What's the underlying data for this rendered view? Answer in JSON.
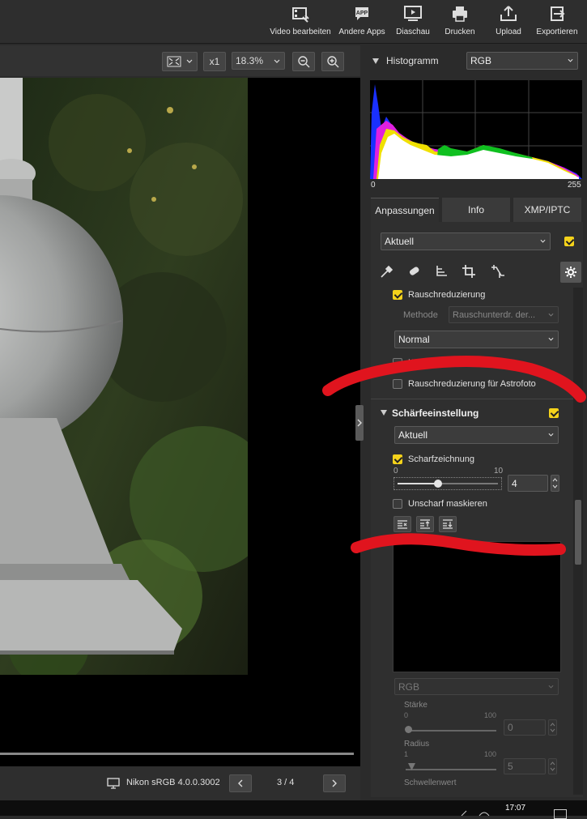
{
  "toolbar": {
    "items": [
      {
        "label": "Video bearbeiten",
        "icon": "video-edit-icon"
      },
      {
        "label": "Andere Apps",
        "icon": "apps-icon"
      },
      {
        "label": "Diaschau",
        "icon": "slideshow-icon"
      },
      {
        "label": "Drucken",
        "icon": "print-icon"
      },
      {
        "label": "Upload",
        "icon": "upload-icon"
      },
      {
        "label": "Exportieren",
        "icon": "export-icon"
      }
    ]
  },
  "viewer_bar": {
    "zoom_ratio_label": "x1",
    "zoom_level": "18.3%"
  },
  "status": {
    "color_profile": "Nikon sRGB 4.0.0.3002",
    "page_indicator": "3 / 4"
  },
  "taskbar": {
    "time": "17:07"
  },
  "histogram": {
    "title": "Histogramm",
    "channel": "RGB",
    "axis_min": "0",
    "axis_max": "255"
  },
  "tabs": [
    {
      "label": "Anpassungen",
      "active": true
    },
    {
      "label": "Info",
      "active": false
    },
    {
      "label": "XMP/IPTC",
      "active": false
    }
  ],
  "adjust": {
    "preset": "Aktuell",
    "enabled": true
  },
  "noise": {
    "title": "Rauschreduzierung",
    "method_label": "Methode",
    "method_value": "Rauschunterdr. der...",
    "strength_value": "Normal",
    "option_1": "Kontrast erhalten",
    "option_2": "Rauschreduzierung für Astrofoto"
  },
  "sharpen": {
    "title": "Schärfeeinstellung",
    "preset": "Aktuell",
    "sharp_title": "Scharfzeichnung",
    "slider_min": "0",
    "slider_max": "10",
    "slider_value": "4",
    "unsharp_title": "Unscharf maskieren",
    "channel": "RGB",
    "staerke_label": "Stärke",
    "staerke_min": "0",
    "staerke_max": "100",
    "staerke_value": "0",
    "radius_label": "Radius",
    "radius_min": "1",
    "radius_max": "100",
    "radius_value": "5",
    "threshold_label": "Schwellenwert"
  },
  "colors": {
    "accent": "#f4d21b",
    "annotation": "#e0141e"
  }
}
